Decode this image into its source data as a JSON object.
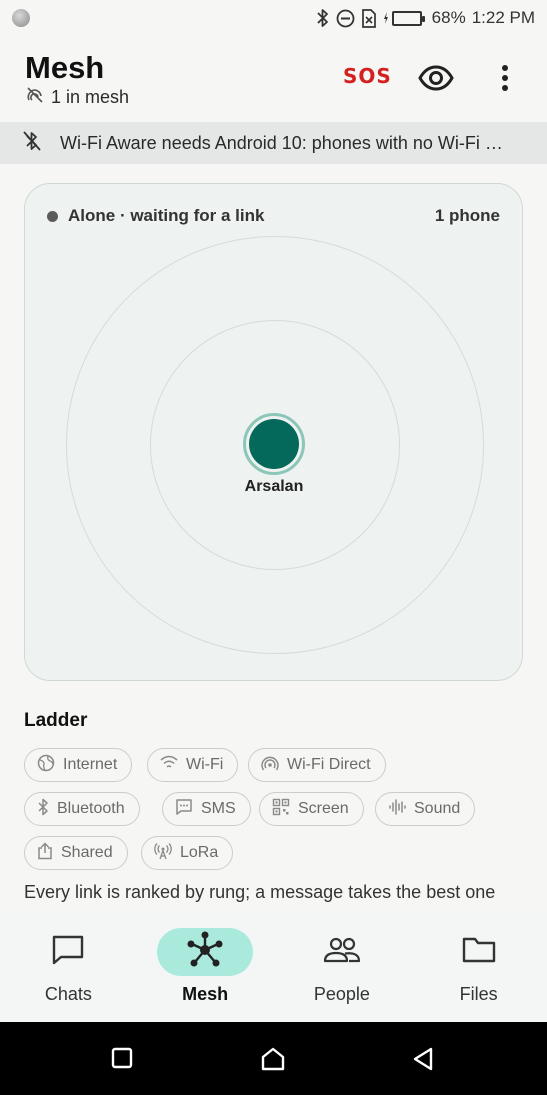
{
  "status_bar": {
    "battery_percent": "68%",
    "time": "1:22 PM",
    "battery_level": 0.68,
    "icons": [
      "bluetooth-icon",
      "do-not-disturb-icon",
      "no-sim-icon",
      "battery-charging-icon"
    ]
  },
  "app_bar": {
    "title": "Mesh",
    "subtitle": "1 in mesh",
    "sos_label": "SOS"
  },
  "banner": {
    "text": "Wi-Fi Aware needs Android 10: phones with no Wi-Fi …"
  },
  "radar": {
    "status_text": "Alone · waiting for a link",
    "peer_count": "1 phone",
    "self_name": "Arsalan",
    "colors": {
      "node": "#04695a",
      "node_ring": "#8cc6b9"
    }
  },
  "ladder": {
    "title": "Ladder",
    "chips": [
      {
        "label": "Internet",
        "icon": "globe-icon"
      },
      {
        "label": "Wi-Fi",
        "icon": "wifi-icon"
      },
      {
        "label": "Wi-Fi Direct",
        "icon": "wifi-direct-icon"
      },
      {
        "label": "Bluetooth",
        "icon": "bluetooth-icon"
      },
      {
        "label": "SMS",
        "icon": "sms-icon"
      },
      {
        "label": "Screen",
        "icon": "qr-code-icon"
      },
      {
        "label": "Sound",
        "icon": "sound-wave-icon"
      },
      {
        "label": "Shared",
        "icon": "share-icon"
      },
      {
        "label": "LoRa",
        "icon": "antenna-icon"
      }
    ],
    "description": "Every link is ranked by rung; a message takes the best one"
  },
  "bottom_nav": {
    "items": [
      {
        "label": "Chats",
        "icon": "chat-icon"
      },
      {
        "label": "Mesh",
        "icon": "mesh-icon",
        "active": true
      },
      {
        "label": "People",
        "icon": "people-icon"
      },
      {
        "label": "Files",
        "icon": "folder-icon"
      }
    ]
  },
  "colors": {
    "accent": "#a9eadd",
    "sos": "#d32020",
    "battery_fill": "#2aa84a"
  }
}
